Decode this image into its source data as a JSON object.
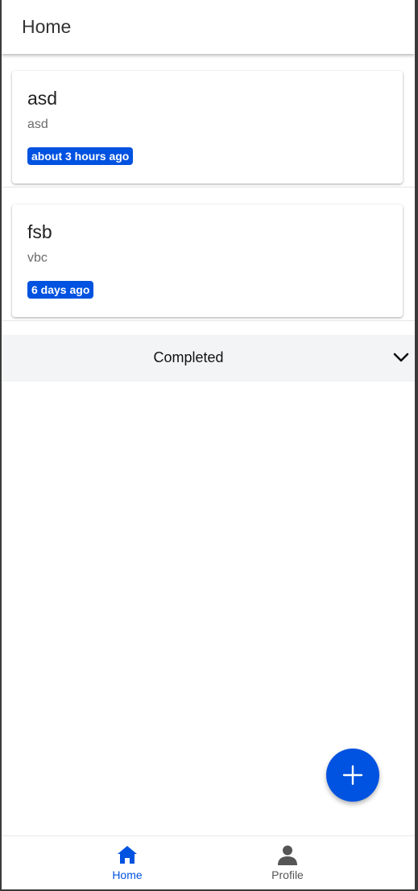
{
  "appbar": {
    "title": "Home"
  },
  "tasks": [
    {
      "title": "asd",
      "description": "asd",
      "time": "about 3 hours ago"
    },
    {
      "title": "fsb",
      "description": "vbc",
      "time": "6 days ago"
    }
  ],
  "completed_section": {
    "label": "Completed",
    "icon": "chevron-down-icon"
  },
  "fab": {
    "icon": "plus-icon"
  },
  "bottom_nav": {
    "items": [
      {
        "label": "Home",
        "icon": "home-icon",
        "active": true
      },
      {
        "label": "Profile",
        "icon": "person-icon",
        "active": false
      }
    ]
  },
  "colors": {
    "accent": "#0052e0",
    "section_bg": "#f3f4f6",
    "inactive_nav": "#555555"
  }
}
